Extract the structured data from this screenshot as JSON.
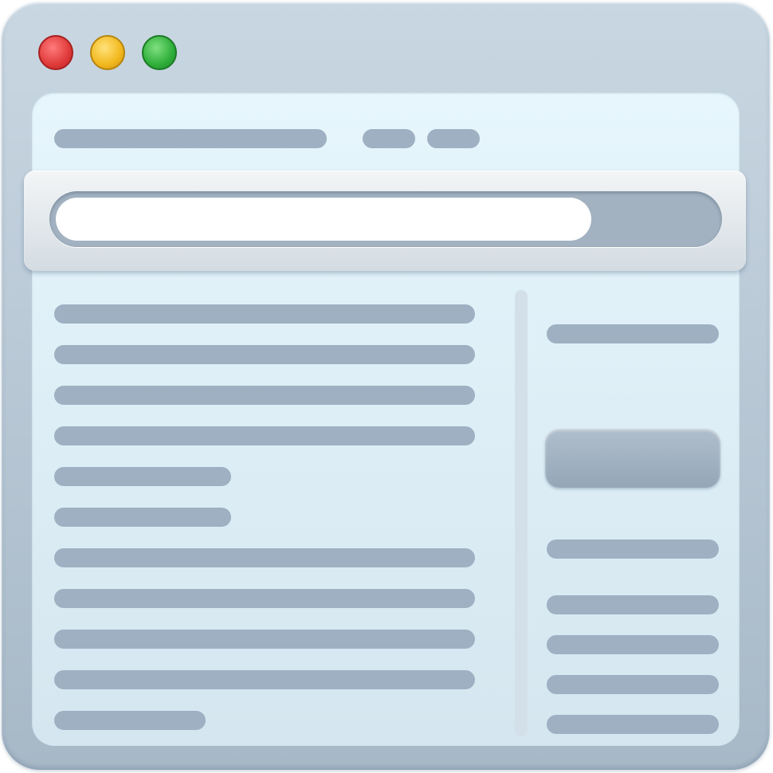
{
  "colors": {
    "frame_top": "#c9d7e2",
    "frame_bottom": "#a7b8c7",
    "panel_top": "#e6f6fc",
    "panel_bottom": "#d6e6f0",
    "line": "#9eb0c2"
  },
  "window_controls": [
    {
      "name": "close",
      "color": "#e03a3a"
    },
    {
      "name": "minimize",
      "color": "#f2b81e"
    },
    {
      "name": "maximize",
      "color": "#2fae3a"
    }
  ],
  "address_bar": {
    "value": "",
    "placeholder": ""
  },
  "sidebar": {
    "button_label": ""
  }
}
